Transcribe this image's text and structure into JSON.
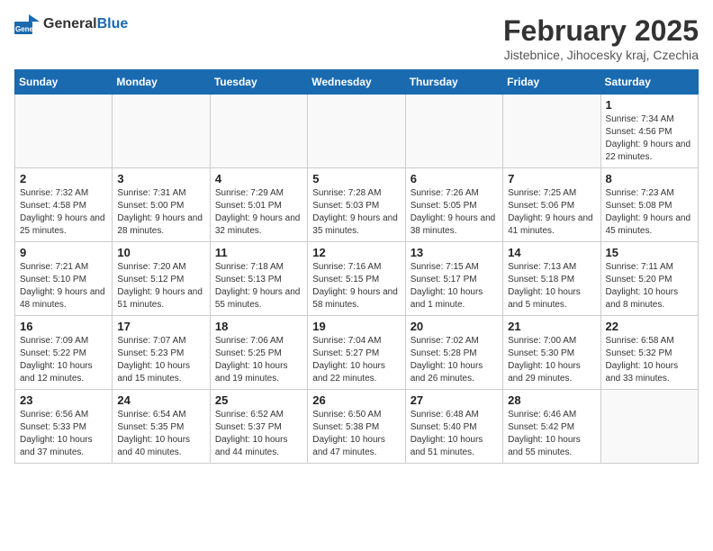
{
  "header": {
    "logo": {
      "general": "General",
      "blue": "Blue"
    },
    "title": "February 2025",
    "subtitle": "Jistebnice, Jihocesky kraj, Czechia"
  },
  "calendar": {
    "weekdays": [
      "Sunday",
      "Monday",
      "Tuesday",
      "Wednesday",
      "Thursday",
      "Friday",
      "Saturday"
    ],
    "weeks": [
      [
        {
          "day": null
        },
        {
          "day": null
        },
        {
          "day": null
        },
        {
          "day": null
        },
        {
          "day": null
        },
        {
          "day": null
        },
        {
          "day": 1,
          "sunrise": "7:34 AM",
          "sunset": "4:56 PM",
          "daylight": "9 hours and 22 minutes."
        }
      ],
      [
        {
          "day": 2,
          "sunrise": "7:32 AM",
          "sunset": "4:58 PM",
          "daylight": "9 hours and 25 minutes."
        },
        {
          "day": 3,
          "sunrise": "7:31 AM",
          "sunset": "5:00 PM",
          "daylight": "9 hours and 28 minutes."
        },
        {
          "day": 4,
          "sunrise": "7:29 AM",
          "sunset": "5:01 PM",
          "daylight": "9 hours and 32 minutes."
        },
        {
          "day": 5,
          "sunrise": "7:28 AM",
          "sunset": "5:03 PM",
          "daylight": "9 hours and 35 minutes."
        },
        {
          "day": 6,
          "sunrise": "7:26 AM",
          "sunset": "5:05 PM",
          "daylight": "9 hours and 38 minutes."
        },
        {
          "day": 7,
          "sunrise": "7:25 AM",
          "sunset": "5:06 PM",
          "daylight": "9 hours and 41 minutes."
        },
        {
          "day": 8,
          "sunrise": "7:23 AM",
          "sunset": "5:08 PM",
          "daylight": "9 hours and 45 minutes."
        }
      ],
      [
        {
          "day": 9,
          "sunrise": "7:21 AM",
          "sunset": "5:10 PM",
          "daylight": "9 hours and 48 minutes."
        },
        {
          "day": 10,
          "sunrise": "7:20 AM",
          "sunset": "5:12 PM",
          "daylight": "9 hours and 51 minutes."
        },
        {
          "day": 11,
          "sunrise": "7:18 AM",
          "sunset": "5:13 PM",
          "daylight": "9 hours and 55 minutes."
        },
        {
          "day": 12,
          "sunrise": "7:16 AM",
          "sunset": "5:15 PM",
          "daylight": "9 hours and 58 minutes."
        },
        {
          "day": 13,
          "sunrise": "7:15 AM",
          "sunset": "5:17 PM",
          "daylight": "10 hours and 1 minute."
        },
        {
          "day": 14,
          "sunrise": "7:13 AM",
          "sunset": "5:18 PM",
          "daylight": "10 hours and 5 minutes."
        },
        {
          "day": 15,
          "sunrise": "7:11 AM",
          "sunset": "5:20 PM",
          "daylight": "10 hours and 8 minutes."
        }
      ],
      [
        {
          "day": 16,
          "sunrise": "7:09 AM",
          "sunset": "5:22 PM",
          "daylight": "10 hours and 12 minutes."
        },
        {
          "day": 17,
          "sunrise": "7:07 AM",
          "sunset": "5:23 PM",
          "daylight": "10 hours and 15 minutes."
        },
        {
          "day": 18,
          "sunrise": "7:06 AM",
          "sunset": "5:25 PM",
          "daylight": "10 hours and 19 minutes."
        },
        {
          "day": 19,
          "sunrise": "7:04 AM",
          "sunset": "5:27 PM",
          "daylight": "10 hours and 22 minutes."
        },
        {
          "day": 20,
          "sunrise": "7:02 AM",
          "sunset": "5:28 PM",
          "daylight": "10 hours and 26 minutes."
        },
        {
          "day": 21,
          "sunrise": "7:00 AM",
          "sunset": "5:30 PM",
          "daylight": "10 hours and 29 minutes."
        },
        {
          "day": 22,
          "sunrise": "6:58 AM",
          "sunset": "5:32 PM",
          "daylight": "10 hours and 33 minutes."
        }
      ],
      [
        {
          "day": 23,
          "sunrise": "6:56 AM",
          "sunset": "5:33 PM",
          "daylight": "10 hours and 37 minutes."
        },
        {
          "day": 24,
          "sunrise": "6:54 AM",
          "sunset": "5:35 PM",
          "daylight": "10 hours and 40 minutes."
        },
        {
          "day": 25,
          "sunrise": "6:52 AM",
          "sunset": "5:37 PM",
          "daylight": "10 hours and 44 minutes."
        },
        {
          "day": 26,
          "sunrise": "6:50 AM",
          "sunset": "5:38 PM",
          "daylight": "10 hours and 47 minutes."
        },
        {
          "day": 27,
          "sunrise": "6:48 AM",
          "sunset": "5:40 PM",
          "daylight": "10 hours and 51 minutes."
        },
        {
          "day": 28,
          "sunrise": "6:46 AM",
          "sunset": "5:42 PM",
          "daylight": "10 hours and 55 minutes."
        },
        {
          "day": null
        }
      ]
    ]
  }
}
